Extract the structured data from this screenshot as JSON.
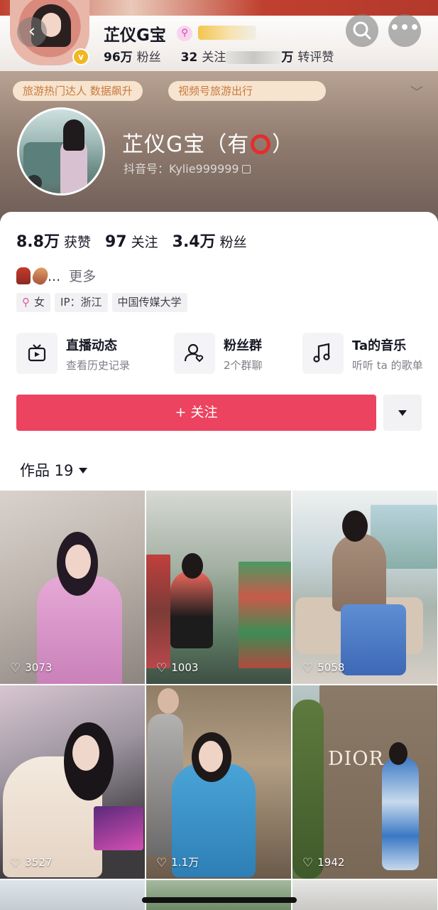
{
  "header": {
    "back_glyph": "‹",
    "top_name": "芷仪G宝",
    "followers_count": "96万",
    "followers_label": "粉丝",
    "following_count_partial": "32",
    "following_label_partial": "关注",
    "likes_label_partial": "万",
    "likes_label": "转评赞",
    "more_glyph": "•••"
  },
  "tags": {
    "tag1": "旅游热门达人 数据飙升",
    "tag2": "视频号旅游出行"
  },
  "profile": {
    "name_part1": "芷仪G宝（有",
    "name_part2": "）",
    "douyin_id": "抖音号：Kylie999999"
  },
  "stats": {
    "likes_count": "8.8万",
    "likes_label": "获赞",
    "following_count": "97",
    "following_label": "关注",
    "fans_count": "3.4万",
    "fans_label": "粉丝"
  },
  "bio": {
    "ellipsis": "...",
    "more": "更多"
  },
  "info_tags": {
    "gender_icon": "⚲",
    "gender": "女",
    "ip": "IP：浙江",
    "school": "中国传媒大学"
  },
  "features": [
    {
      "title": "直播动态",
      "sub": "查看历史记录",
      "icon": "tv-icon"
    },
    {
      "title": "粉丝群",
      "sub": "2个群聊",
      "icon": "fan-group-icon"
    },
    {
      "title": "Ta的音乐",
      "sub": "听听 ta 的歌单",
      "icon": "music-note-icon"
    }
  ],
  "follow_button": "+ 关注",
  "works_tab": "作品 19",
  "videos": [
    {
      "likes": "3073"
    },
    {
      "likes": "1003"
    },
    {
      "likes": "5058"
    },
    {
      "likes": "3527"
    },
    {
      "likes": "1.1万"
    },
    {
      "likes": "1942",
      "sign_text": "DIOR"
    }
  ],
  "colors": {
    "follow_red": "#ec4460",
    "tag_orange": "#c8793e",
    "verify_gold": "#f2b623"
  }
}
